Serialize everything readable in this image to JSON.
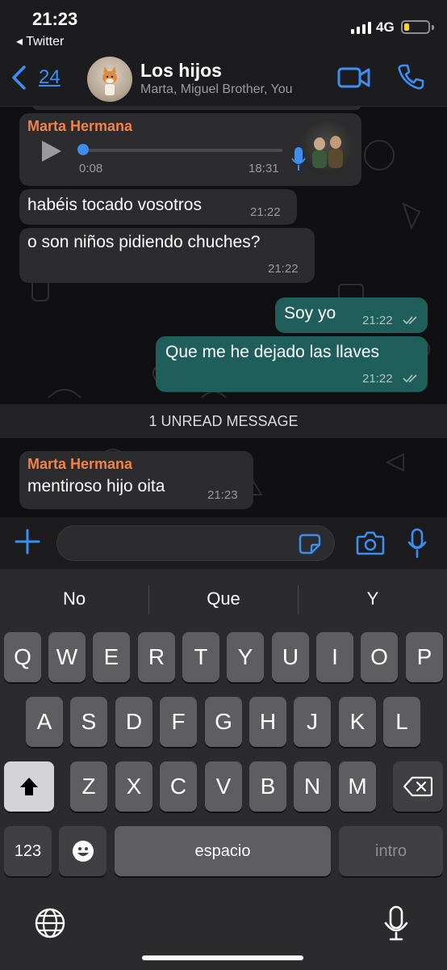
{
  "status_bar": {
    "time": "21:23",
    "back_app": "◂ Twitter",
    "network": "4G",
    "battery_level": 0.2,
    "battery_color": "#ffd60a"
  },
  "header": {
    "back_count": "24",
    "title": "Los hijos",
    "subtitle": "Marta, Miguel Brother, You",
    "accent": "#3b8ff3"
  },
  "messages": [
    {
      "type": "voice",
      "sender": "Marta Hermana",
      "elapsed": "0:08",
      "time": "18:31",
      "progress": 0.0
    },
    {
      "type": "text",
      "direction": "in",
      "text": "habéis tocado vosotros",
      "time": "21:22"
    },
    {
      "type": "text",
      "direction": "in",
      "text": "o son niños pidiendo chuches?",
      "time": "21:22"
    },
    {
      "type": "text",
      "direction": "out",
      "text": "Soy yo",
      "time": "21:22",
      "status": "read"
    },
    {
      "type": "text",
      "direction": "out",
      "text": "Que me he dejado las llaves",
      "time": "21:22",
      "status": "read"
    },
    {
      "type": "text",
      "direction": "in",
      "sender": "Marta Hermana",
      "text": "mentiroso hijo oita",
      "time": "21:23"
    }
  ],
  "unread_divider": "1 UNREAD MESSAGE",
  "composer": {
    "value": "",
    "placeholder": ""
  },
  "keyboard": {
    "suggestions": [
      "No",
      "Que",
      "Y"
    ],
    "row1": [
      "Q",
      "W",
      "E",
      "R",
      "T",
      "Y",
      "U",
      "I",
      "O",
      "P"
    ],
    "row2": [
      "A",
      "S",
      "D",
      "F",
      "G",
      "H",
      "J",
      "K",
      "L"
    ],
    "row3": [
      "Z",
      "X",
      "C",
      "V",
      "B",
      "N",
      "M"
    ],
    "numbers_label": "123",
    "space_label": "espacio",
    "return_label": "intro"
  },
  "icons": {
    "back": "chevron-left-icon",
    "video": "video-camera-icon",
    "call": "phone-icon",
    "plus": "plus-icon",
    "sticker": "sticker-icon",
    "camera": "camera-icon",
    "mic": "microphone-icon",
    "shift": "shift-arrow-icon",
    "delete": "backspace-icon",
    "emoji": "emoji-icon",
    "globe": "globe-icon",
    "dictation": "dictation-mic-icon"
  }
}
